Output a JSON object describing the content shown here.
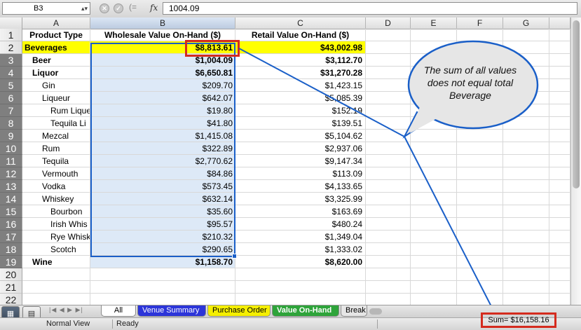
{
  "formula_bar": {
    "cell_ref": "B3",
    "fx_label": "fx",
    "value": "1004.09",
    "cancel_icon": "cancel-icon",
    "confirm_icon": "check-icon"
  },
  "columns": [
    "A",
    "B",
    "C",
    "D",
    "E",
    "F",
    "G"
  ],
  "rows": [
    {
      "num": "1",
      "a": "Product Type",
      "b": "Wholesale Value On-Hand ($)",
      "c": "Retail Value On-Hand ($)"
    },
    {
      "num": "2",
      "a": "Beverages",
      "b": "$8,813.61",
      "c": "$43,002.98"
    },
    {
      "num": "3",
      "a": "Beer",
      "b": "$1,004.09",
      "c": "$3,112.70"
    },
    {
      "num": "4",
      "a": "Liquor",
      "b": "$6,650.81",
      "c": "$31,270.28"
    },
    {
      "num": "5",
      "a": "Gin",
      "b": "$209.70",
      "c": "$1,423.15"
    },
    {
      "num": "6",
      "a": "Liqueur",
      "b": "$642.07",
      "c": "$5,085.39"
    },
    {
      "num": "7",
      "a": "Rum Lique",
      "b": "$19.80",
      "c": "$152.19"
    },
    {
      "num": "8",
      "a": "Tequila Li",
      "b": "$41.80",
      "c": "$139.51"
    },
    {
      "num": "9",
      "a": "Mezcal",
      "b": "$1,415.08",
      "c": "$5,104.62"
    },
    {
      "num": "10",
      "a": "Rum",
      "b": "$322.89",
      "c": "$2,937.06"
    },
    {
      "num": "11",
      "a": "Tequila",
      "b": "$2,770.62",
      "c": "$9,147.34"
    },
    {
      "num": "12",
      "a": "Vermouth",
      "b": "$84.86",
      "c": "$113.09"
    },
    {
      "num": "13",
      "a": "Vodka",
      "b": "$573.45",
      "c": "$4,133.65"
    },
    {
      "num": "14",
      "a": "Whiskey",
      "b": "$632.14",
      "c": "$3,325.99"
    },
    {
      "num": "15",
      "a": "Bourbon",
      "b": "$35.60",
      "c": "$163.69"
    },
    {
      "num": "16",
      "a": "Irish Whis",
      "b": "$95.57",
      "c": "$480.24"
    },
    {
      "num": "17",
      "a": "Rye Whisk",
      "b": "$210.32",
      "c": "$1,349.04"
    },
    {
      "num": "18",
      "a": "Scotch",
      "b": "$290.65",
      "c": "$1,333.02"
    },
    {
      "num": "19",
      "a": "Wine",
      "b": "$1,158.70",
      "c": "$8,620.00"
    },
    {
      "num": "20",
      "a": "",
      "b": "",
      "c": ""
    },
    {
      "num": "21",
      "a": "",
      "b": "",
      "c": ""
    },
    {
      "num": "22",
      "a": "",
      "b": "",
      "c": ""
    }
  ],
  "callout": {
    "text": "The sum of all values does not equal total Beverage"
  },
  "tabs": [
    {
      "label": "All"
    },
    {
      "label": "Venue Summary"
    },
    {
      "label": "Purchase Order"
    },
    {
      "label": "Value On-Hand"
    },
    {
      "label": "Break"
    }
  ],
  "status": {
    "view": "Normal View",
    "state": "Ready",
    "sum": "Sum= $16,158.16"
  },
  "colors": {
    "highlight_yellow": "#ffff00",
    "selection_blue": "#1a5fc8",
    "annotation_red": "#d42b1e",
    "callout_fill": "#e6e6e6"
  }
}
